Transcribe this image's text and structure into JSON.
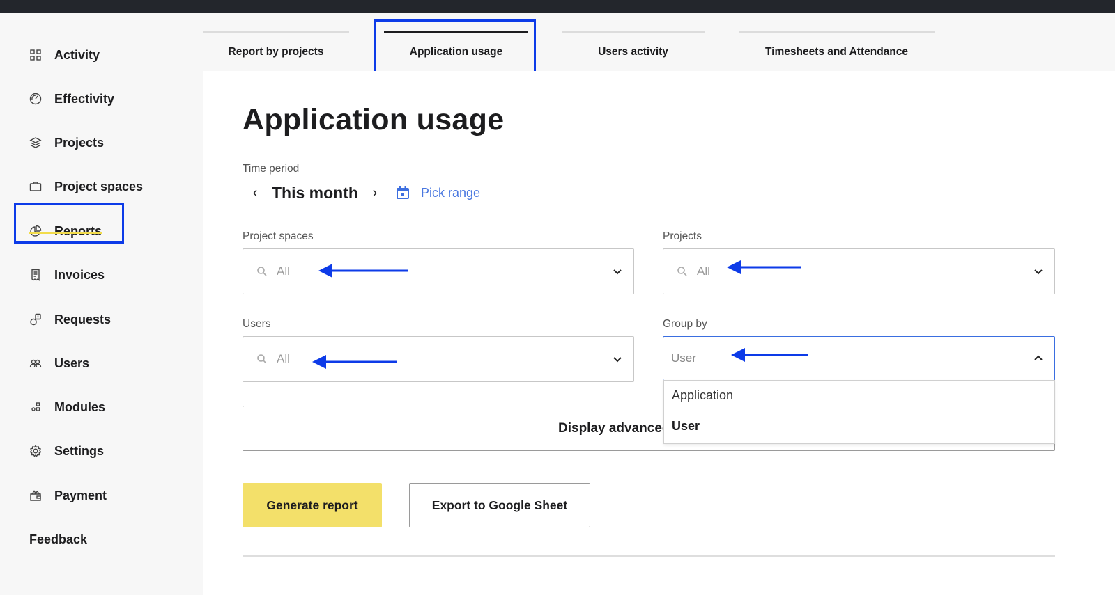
{
  "sidebar": {
    "items": [
      {
        "label": "Activity",
        "icon": "grid-icon"
      },
      {
        "label": "Effectivity",
        "icon": "gauge-icon"
      },
      {
        "label": "Projects",
        "icon": "layers-icon"
      },
      {
        "label": "Project spaces",
        "icon": "briefcase-icon"
      },
      {
        "label": "Reports",
        "icon": "pie-chart-icon"
      },
      {
        "label": "Invoices",
        "icon": "receipt-icon"
      },
      {
        "label": "Requests",
        "icon": "request-icon"
      },
      {
        "label": "Users",
        "icon": "users-icon"
      },
      {
        "label": "Modules",
        "icon": "modules-icon"
      },
      {
        "label": "Settings",
        "icon": "gear-icon"
      },
      {
        "label": "Payment",
        "icon": "payment-icon"
      }
    ],
    "feedback": "Feedback",
    "active": "Reports"
  },
  "tabs": [
    {
      "label": "Report by projects"
    },
    {
      "label": "Application usage"
    },
    {
      "label": "Users activity"
    },
    {
      "label": "Timesheets and Attendance"
    }
  ],
  "active_tab": "Application usage",
  "main": {
    "title": "Application usage",
    "time_period": {
      "label": "Time period",
      "value": "This month",
      "pick_range": "Pick range"
    },
    "project_spaces": {
      "label": "Project spaces",
      "value": "All"
    },
    "projects": {
      "label": "Projects",
      "value": "All"
    },
    "users": {
      "label": "Users",
      "value": "All"
    },
    "group_by": {
      "label": "Group by",
      "value": "User",
      "options": [
        "Application",
        "User"
      ],
      "selected": "User"
    },
    "advanced_button": "Display advanced",
    "generate_button": "Generate report",
    "export_button": "Export to Google Sheet"
  },
  "colors": {
    "highlight": "#0d3be8",
    "accent_yellow": "#f3e06a",
    "link_blue": "#4a78e0",
    "topbar": "#23262c"
  }
}
